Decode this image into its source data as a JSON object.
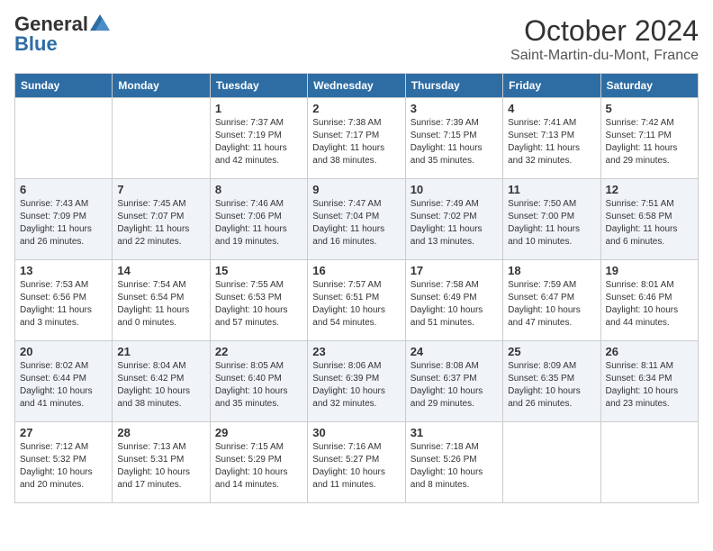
{
  "header": {
    "logo_general": "General",
    "logo_blue": "Blue",
    "month": "October 2024",
    "location": "Saint-Martin-du-Mont, France"
  },
  "days_of_week": [
    "Sunday",
    "Monday",
    "Tuesday",
    "Wednesday",
    "Thursday",
    "Friday",
    "Saturday"
  ],
  "weeks": [
    [
      {
        "day": "",
        "info": ""
      },
      {
        "day": "",
        "info": ""
      },
      {
        "day": "1",
        "info": "Sunrise: 7:37 AM\nSunset: 7:19 PM\nDaylight: 11 hours and 42 minutes."
      },
      {
        "day": "2",
        "info": "Sunrise: 7:38 AM\nSunset: 7:17 PM\nDaylight: 11 hours and 38 minutes."
      },
      {
        "day": "3",
        "info": "Sunrise: 7:39 AM\nSunset: 7:15 PM\nDaylight: 11 hours and 35 minutes."
      },
      {
        "day": "4",
        "info": "Sunrise: 7:41 AM\nSunset: 7:13 PM\nDaylight: 11 hours and 32 minutes."
      },
      {
        "day": "5",
        "info": "Sunrise: 7:42 AM\nSunset: 7:11 PM\nDaylight: 11 hours and 29 minutes."
      }
    ],
    [
      {
        "day": "6",
        "info": "Sunrise: 7:43 AM\nSunset: 7:09 PM\nDaylight: 11 hours and 26 minutes."
      },
      {
        "day": "7",
        "info": "Sunrise: 7:45 AM\nSunset: 7:07 PM\nDaylight: 11 hours and 22 minutes."
      },
      {
        "day": "8",
        "info": "Sunrise: 7:46 AM\nSunset: 7:06 PM\nDaylight: 11 hours and 19 minutes."
      },
      {
        "day": "9",
        "info": "Sunrise: 7:47 AM\nSunset: 7:04 PM\nDaylight: 11 hours and 16 minutes."
      },
      {
        "day": "10",
        "info": "Sunrise: 7:49 AM\nSunset: 7:02 PM\nDaylight: 11 hours and 13 minutes."
      },
      {
        "day": "11",
        "info": "Sunrise: 7:50 AM\nSunset: 7:00 PM\nDaylight: 11 hours and 10 minutes."
      },
      {
        "day": "12",
        "info": "Sunrise: 7:51 AM\nSunset: 6:58 PM\nDaylight: 11 hours and 6 minutes."
      }
    ],
    [
      {
        "day": "13",
        "info": "Sunrise: 7:53 AM\nSunset: 6:56 PM\nDaylight: 11 hours and 3 minutes."
      },
      {
        "day": "14",
        "info": "Sunrise: 7:54 AM\nSunset: 6:54 PM\nDaylight: 11 hours and 0 minutes."
      },
      {
        "day": "15",
        "info": "Sunrise: 7:55 AM\nSunset: 6:53 PM\nDaylight: 10 hours and 57 minutes."
      },
      {
        "day": "16",
        "info": "Sunrise: 7:57 AM\nSunset: 6:51 PM\nDaylight: 10 hours and 54 minutes."
      },
      {
        "day": "17",
        "info": "Sunrise: 7:58 AM\nSunset: 6:49 PM\nDaylight: 10 hours and 51 minutes."
      },
      {
        "day": "18",
        "info": "Sunrise: 7:59 AM\nSunset: 6:47 PM\nDaylight: 10 hours and 47 minutes."
      },
      {
        "day": "19",
        "info": "Sunrise: 8:01 AM\nSunset: 6:46 PM\nDaylight: 10 hours and 44 minutes."
      }
    ],
    [
      {
        "day": "20",
        "info": "Sunrise: 8:02 AM\nSunset: 6:44 PM\nDaylight: 10 hours and 41 minutes."
      },
      {
        "day": "21",
        "info": "Sunrise: 8:04 AM\nSunset: 6:42 PM\nDaylight: 10 hours and 38 minutes."
      },
      {
        "day": "22",
        "info": "Sunrise: 8:05 AM\nSunset: 6:40 PM\nDaylight: 10 hours and 35 minutes."
      },
      {
        "day": "23",
        "info": "Sunrise: 8:06 AM\nSunset: 6:39 PM\nDaylight: 10 hours and 32 minutes."
      },
      {
        "day": "24",
        "info": "Sunrise: 8:08 AM\nSunset: 6:37 PM\nDaylight: 10 hours and 29 minutes."
      },
      {
        "day": "25",
        "info": "Sunrise: 8:09 AM\nSunset: 6:35 PM\nDaylight: 10 hours and 26 minutes."
      },
      {
        "day": "26",
        "info": "Sunrise: 8:11 AM\nSunset: 6:34 PM\nDaylight: 10 hours and 23 minutes."
      }
    ],
    [
      {
        "day": "27",
        "info": "Sunrise: 7:12 AM\nSunset: 5:32 PM\nDaylight: 10 hours and 20 minutes."
      },
      {
        "day": "28",
        "info": "Sunrise: 7:13 AM\nSunset: 5:31 PM\nDaylight: 10 hours and 17 minutes."
      },
      {
        "day": "29",
        "info": "Sunrise: 7:15 AM\nSunset: 5:29 PM\nDaylight: 10 hours and 14 minutes."
      },
      {
        "day": "30",
        "info": "Sunrise: 7:16 AM\nSunset: 5:27 PM\nDaylight: 10 hours and 11 minutes."
      },
      {
        "day": "31",
        "info": "Sunrise: 7:18 AM\nSunset: 5:26 PM\nDaylight: 10 hours and 8 minutes."
      },
      {
        "day": "",
        "info": ""
      },
      {
        "day": "",
        "info": ""
      }
    ]
  ]
}
